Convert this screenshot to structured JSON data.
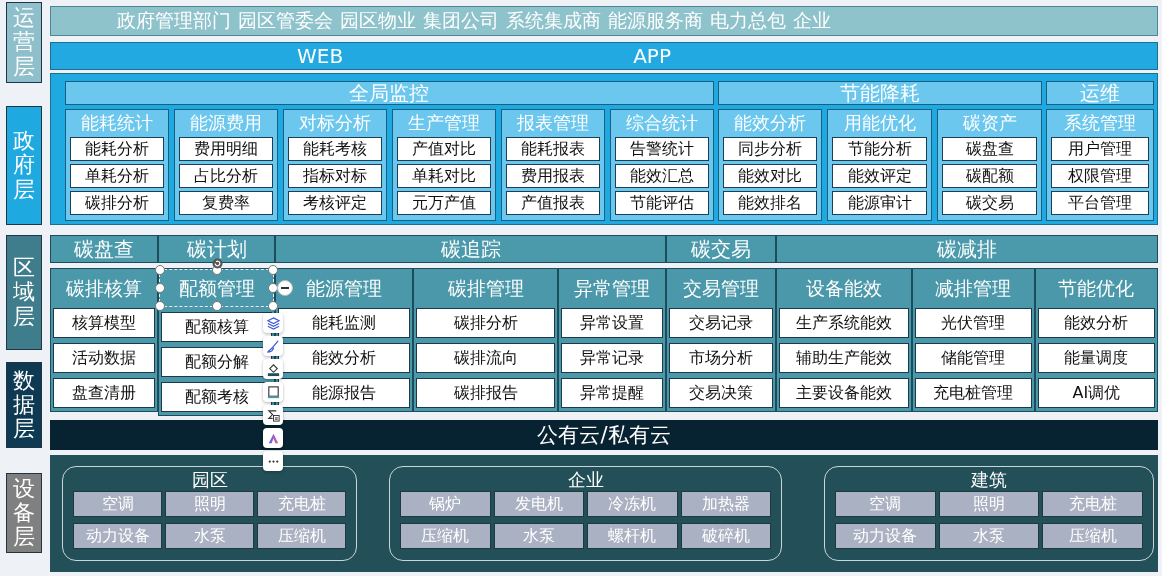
{
  "layers": [
    {
      "name": "运营层",
      "color": "#8fbfca"
    },
    {
      "name": "政府层",
      "color": "#1fa9e1"
    },
    {
      "name": "区域层",
      "color": "#3f7d8c"
    },
    {
      "name": "数据层",
      "color": "#0d3a52"
    },
    {
      "name": "设备层",
      "color": "#808080"
    }
  ],
  "roles": [
    "政府管理部门",
    "园区管委会",
    "园区物业",
    "集团公司",
    "系统集成商",
    "能源服务商",
    "电力总包",
    "企业"
  ],
  "channels": [
    "WEB",
    "APP"
  ],
  "government": {
    "groups": [
      {
        "title": "全局监控",
        "cards": [
          {
            "title": "能耗统计",
            "items": [
              "能耗分析",
              "单耗分析",
              "碳排分析"
            ]
          },
          {
            "title": "能源费用",
            "items": [
              "费用明细",
              "占比分析",
              "复费率"
            ]
          },
          {
            "title": "对标分析",
            "items": [
              "能耗考核",
              "指标对标",
              "考核评定"
            ]
          },
          {
            "title": "生产管理",
            "items": [
              "产值对比",
              "单耗对比",
              "元万产值"
            ]
          },
          {
            "title": "报表管理",
            "items": [
              "能耗报表",
              "费用报表",
              "产值报表"
            ]
          },
          {
            "title": "综合统计",
            "items": [
              "告警统计",
              "能效汇总",
              "节能评估"
            ]
          }
        ]
      },
      {
        "title": "节能降耗",
        "cards": [
          {
            "title": "能效分析",
            "items": [
              "同步分析",
              "能效对比",
              "能效排名"
            ]
          },
          {
            "title": "用能优化",
            "items": [
              "节能分析",
              "能效评定",
              "能源审计"
            ]
          },
          {
            "title": "碳资产",
            "items": [
              "碳盘查",
              "碳配额",
              "碳交易"
            ]
          }
        ]
      },
      {
        "title": "运维",
        "cards": [
          {
            "title": "系统管理",
            "items": [
              "用户管理",
              "权限管理",
              "平台管理"
            ]
          }
        ]
      }
    ]
  },
  "region": {
    "groups": [
      {
        "title": "碳盘查",
        "cards": [
          {
            "title": "碳排核算",
            "selected": false,
            "items": [
              "核算模型",
              "活动数据",
              "盘查清册"
            ]
          }
        ]
      },
      {
        "title": "碳计划",
        "cards": [
          {
            "title": "配额管理",
            "selected": true,
            "items": [
              "配额核算",
              "配额分解",
              "配额考核"
            ]
          }
        ]
      },
      {
        "title": "碳追踪",
        "cards": [
          {
            "title": "能源管理",
            "selected": false,
            "items": [
              "能耗监测",
              "能效分析",
              "能源报告"
            ]
          },
          {
            "title": "碳排管理",
            "selected": false,
            "items": [
              "碳排分析",
              "碳排流向",
              "碳排报告"
            ]
          },
          {
            "title": "异常管理",
            "selected": false,
            "items": [
              "异常设置",
              "异常记录",
              "异常提醒"
            ]
          }
        ]
      },
      {
        "title": "碳交易",
        "cards": [
          {
            "title": "交易管理",
            "selected": false,
            "items": [
              "交易记录",
              "市场分析",
              "交易决策"
            ]
          }
        ]
      },
      {
        "title": "碳减排",
        "cards": [
          {
            "title": "设备能效",
            "selected": false,
            "items": [
              "生产系统能效",
              "辅助生产能效",
              "主要设备能效"
            ]
          },
          {
            "title": "减排管理",
            "selected": false,
            "items": [
              "光伏管理",
              "储能管理",
              "充电桩管理"
            ]
          },
          {
            "title": "节能优化",
            "selected": false,
            "items": [
              "能效分析",
              "能量调度",
              "AI调优"
            ]
          }
        ]
      }
    ]
  },
  "cloud": "公有云/私有云",
  "devices": [
    {
      "title": "园区",
      "items": [
        "空调",
        "照明",
        "充电桩",
        "动力设备",
        "水泵",
        "压缩机"
      ]
    },
    {
      "title": "企业",
      "items": [
        "锅炉",
        "发电机",
        "冷冻机",
        "加热器",
        "压缩机",
        "水泵",
        "螺杆机",
        "破碎机"
      ]
    },
    {
      "title": "建筑",
      "items": [
        "空调",
        "照明",
        "充电桩",
        "动力设备",
        "水泵",
        "压缩机"
      ]
    }
  ]
}
